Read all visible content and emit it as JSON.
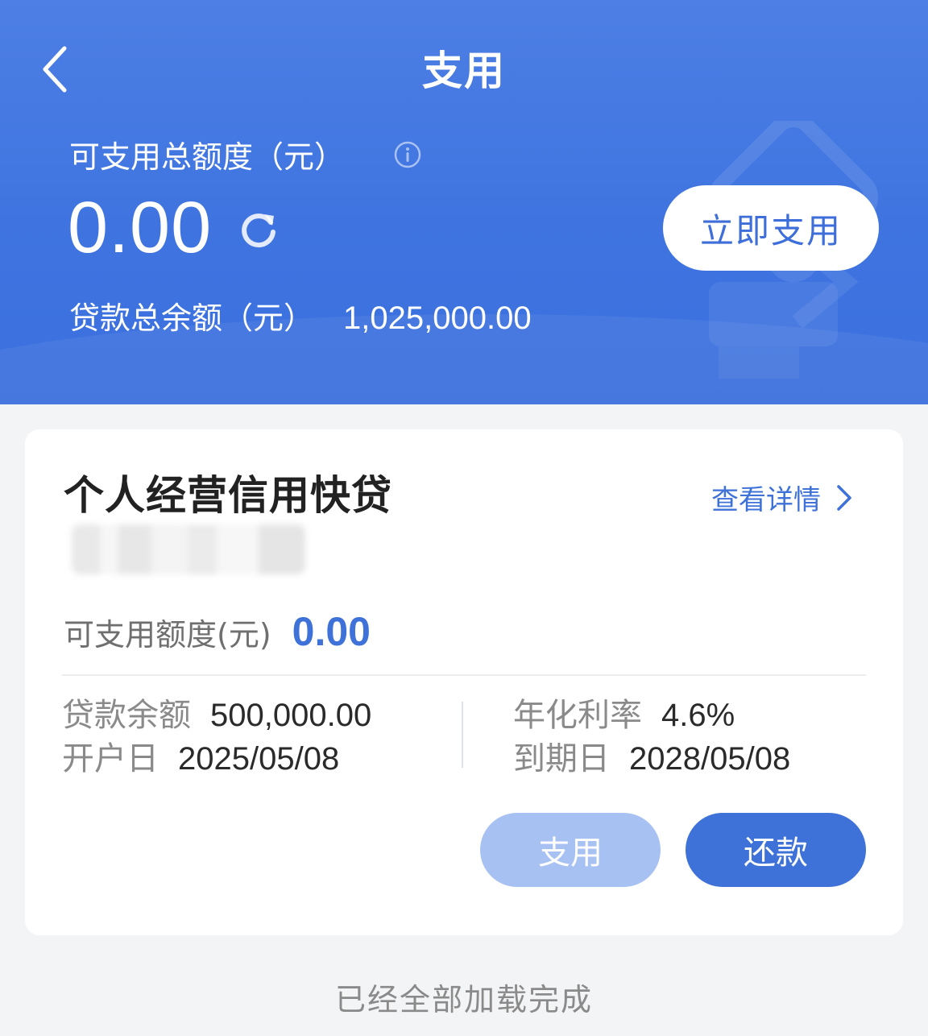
{
  "header": {
    "title": "支用",
    "quota_label": "可支用总额度（元）",
    "quota_value": "0.00",
    "use_now_label": "立即支用",
    "balance_label": "贷款总余额（元）",
    "balance_value": "1,025,000.00"
  },
  "card": {
    "product_name": "个人经营信用快贷",
    "detail_link": "查看详情",
    "available_label": "可支用额度(元)",
    "available_value": "0.00",
    "loan_balance_label": "贷款余额",
    "loan_balance_value": "500,000.00",
    "rate_label": "年化利率",
    "rate_value": "4.6%",
    "open_date_label": "开户日",
    "open_date_value": "2025/05/08",
    "due_date_label": "到期日",
    "due_date_value": "2028/05/08",
    "use_button": "支用",
    "repay_button": "还款"
  },
  "footer": {
    "status_text": "已经全部加载完成"
  },
  "colors": {
    "header_bg": "#4578e2",
    "accent": "#3f72d8",
    "disabled_button": "#a8c1f3"
  }
}
